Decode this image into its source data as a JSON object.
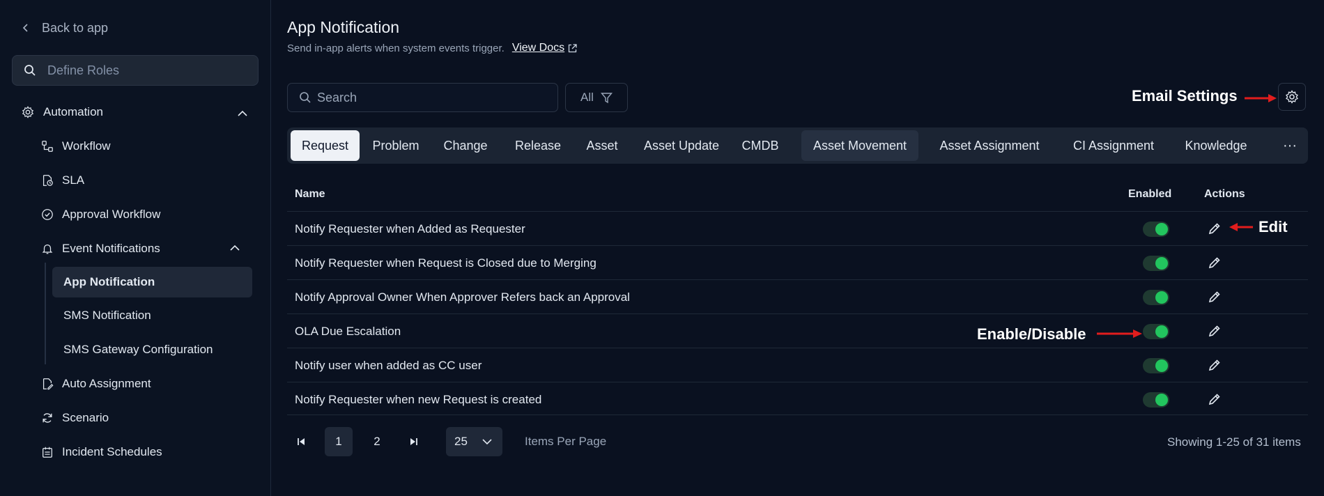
{
  "sidebar": {
    "back_label": "Back to app",
    "search_placeholder": "Define Roles",
    "automation_label": "Automation",
    "items": [
      {
        "label": "Workflow"
      },
      {
        "label": "SLA"
      },
      {
        "label": "Approval Workflow"
      },
      {
        "label": "Event Notifications"
      },
      {
        "label": "Auto Assignment"
      },
      {
        "label": "Scenario"
      },
      {
        "label": "Incident Schedules"
      }
    ],
    "sub_items": [
      {
        "label": "App Notification"
      },
      {
        "label": "SMS Notification"
      },
      {
        "label": "SMS Gateway Configuration"
      }
    ]
  },
  "header": {
    "title": "App Notification",
    "subtitle": "Send in-app alerts when system events trigger.",
    "docs_link": "View Docs"
  },
  "toolbar": {
    "search_placeholder": "Search",
    "filter_label": "All",
    "email_settings_label": "Email Settings"
  },
  "tabs": [
    {
      "label": "Request"
    },
    {
      "label": "Problem"
    },
    {
      "label": "Change"
    },
    {
      "label": "Release"
    },
    {
      "label": "Asset"
    },
    {
      "label": "Asset Update"
    },
    {
      "label": "CMDB"
    },
    {
      "label": "Asset Movement"
    },
    {
      "label": "Asset Assignment"
    },
    {
      "label": "CI Assignment"
    },
    {
      "label": "Knowledge"
    }
  ],
  "tab_more_label": "···",
  "table": {
    "headers": {
      "name": "Name",
      "enabled": "Enabled",
      "actions": "Actions"
    },
    "rows": [
      {
        "name": "Notify Requester when Added as Requester",
        "enabled": true
      },
      {
        "name": "Notify Requester when Request is Closed due to Merging",
        "enabled": true
      },
      {
        "name": "Notify Approval Owner When Approver Refers back an Approval",
        "enabled": true
      },
      {
        "name": "OLA Due Escalation",
        "enabled": true
      },
      {
        "name": "Notify user when added as CC user",
        "enabled": true
      },
      {
        "name": "Notify Requester when new Request is created",
        "enabled": true
      }
    ]
  },
  "annotations": {
    "edit": "Edit",
    "enable_disable": "Enable/Disable"
  },
  "pagination": {
    "pages": [
      "1",
      "2"
    ],
    "current_page": "1",
    "per_page": "25",
    "per_page_label": "Items Per Page",
    "showing": "Showing 1-25 of 31 items"
  },
  "colors": {
    "background": "#0a1120",
    "toggle_on": "#22c55e",
    "annotation_arrow": "#e11d1d"
  }
}
